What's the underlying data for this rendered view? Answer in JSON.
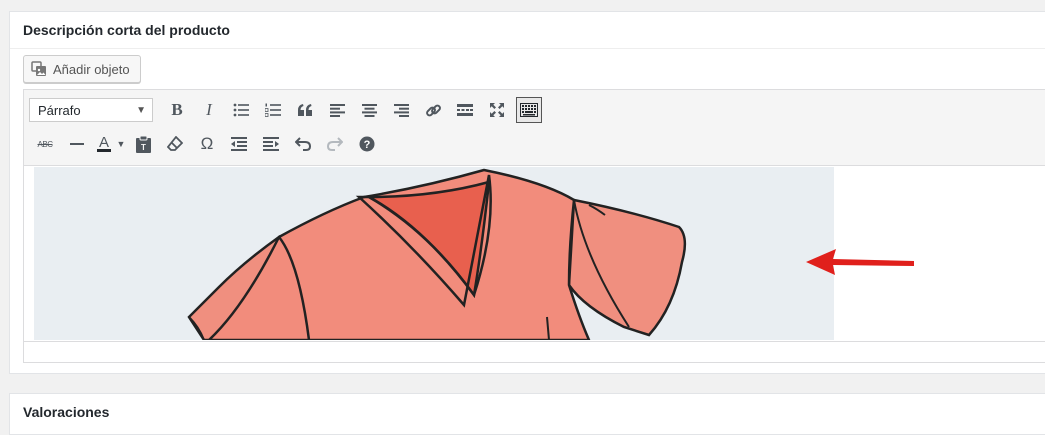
{
  "product_description": {
    "title": "Descripción corta del producto",
    "add_media_label": "Añadir objeto"
  },
  "editor": {
    "format_select": "Párrafo",
    "toolbar_row1_icons": [
      "bold-icon",
      "italic-icon",
      "bullet-list-icon",
      "numbered-list-icon",
      "blockquote-icon",
      "align-left-icon",
      "align-center-icon",
      "align-right-icon",
      "link-icon",
      "read-more-icon",
      "fullscreen-icon",
      "toolbar-toggle-icon"
    ],
    "toolbar_row2_icons": [
      "strikethrough-icon",
      "horizontal-line-icon",
      "text-color-icon",
      "paste-text-icon",
      "clear-formatting-icon",
      "special-character-icon",
      "outdent-icon",
      "indent-icon",
      "undo-icon",
      "redo-icon",
      "help-icon"
    ],
    "bold_glyph": "B",
    "italic_glyph": "I",
    "strike_glyph": "ABC",
    "text_color_glyph": "A",
    "omega_glyph": "Ω",
    "image_alt": "t-shirt illustration"
  },
  "reviews": {
    "title": "Valoraciones"
  },
  "colors": {
    "shirt": "#f08f7f",
    "shirt_shadow": "#e96a5a",
    "arrow": "#e0201c",
    "image_bg": "#e9eef2"
  }
}
